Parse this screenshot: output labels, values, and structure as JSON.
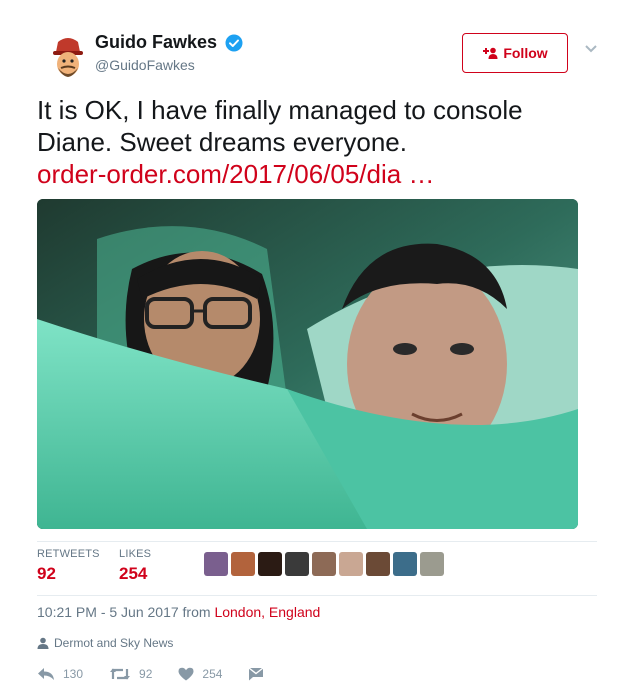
{
  "author": {
    "display_name": "Guido Fawkes",
    "handle": "@GuidoFawkes",
    "verified": true,
    "avatar_icon": "guido-caricature-avatar"
  },
  "follow_button": {
    "label": "Follow",
    "icon": "add-user-icon"
  },
  "menu": {
    "icon": "chevron-down-icon"
  },
  "tweet": {
    "text": "It is OK, I have finally managed to console Diane. Sweet dreams everyone.",
    "link": "order-order.com/2017/06/05/dia …"
  },
  "stats": {
    "retweets_label": "RETWEETS",
    "retweets_value": "92",
    "likes_label": "LIKES",
    "likes_value": "254",
    "liker_count": 9
  },
  "meta": {
    "time": "10:21 PM - 5 Jun 2017 from ",
    "location": "London, England"
  },
  "context": {
    "text": "Dermot and Sky News",
    "icon": "person-icon"
  },
  "actions": {
    "reply_count": "130",
    "retweet_count": "92",
    "like_count": "254"
  },
  "colors": {
    "accent": "#d0021b",
    "muted": "#657786",
    "text": "#14171a",
    "verified": "#1da1f2",
    "action_grey": "#8899a6"
  }
}
